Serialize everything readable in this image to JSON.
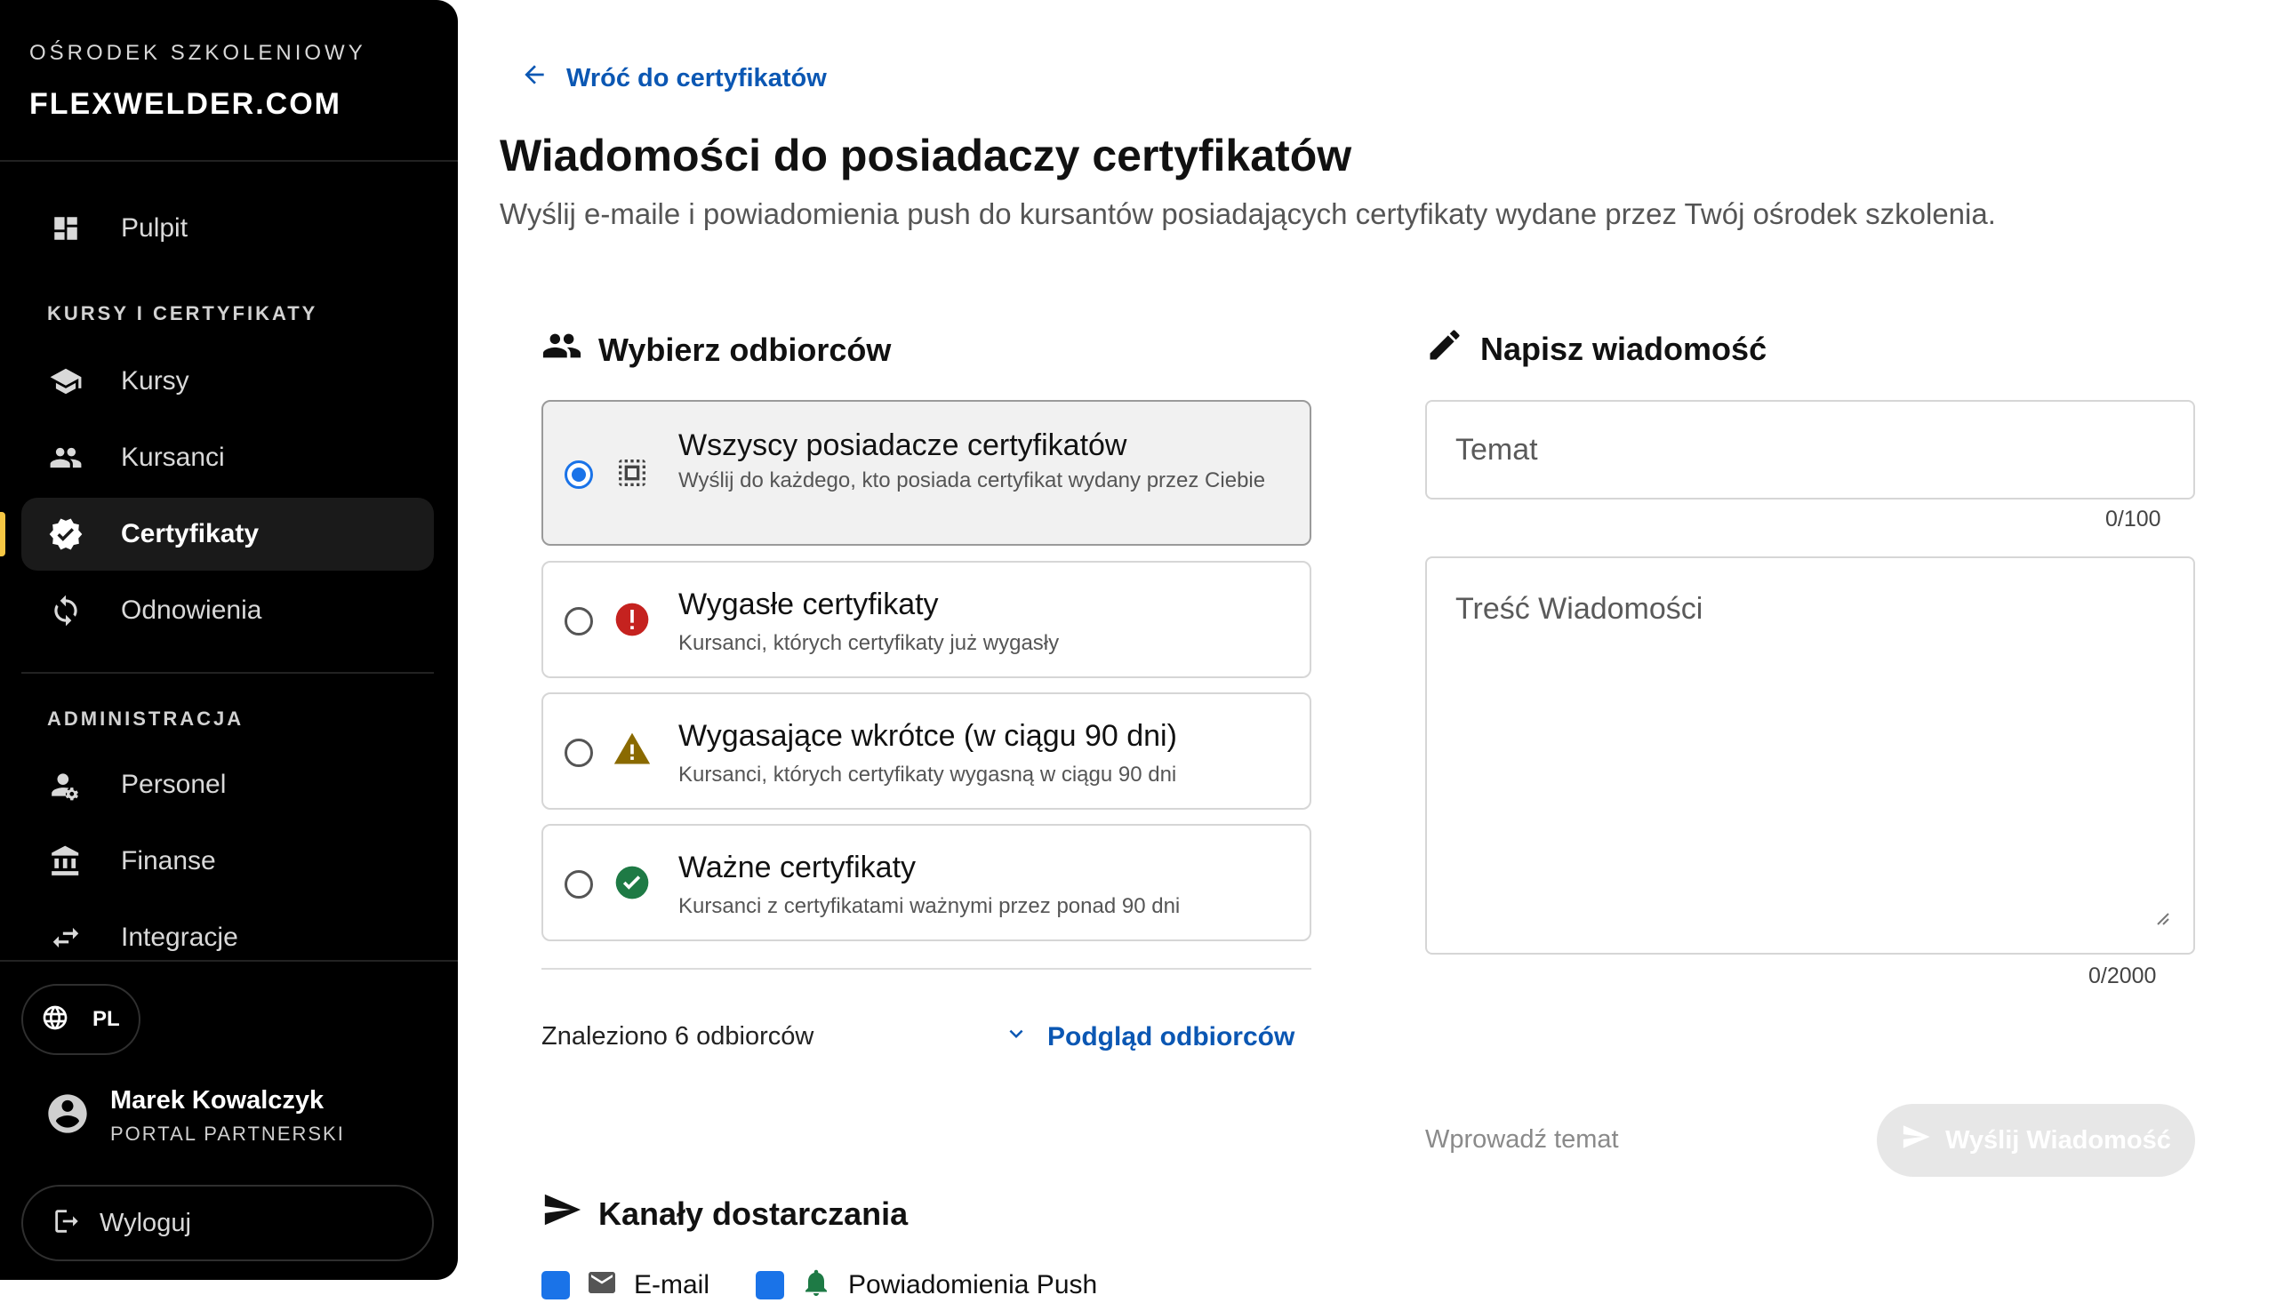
{
  "sidebar": {
    "brand_kicker": "OŚRODEK SZKOLENIOWY",
    "brand_name": "FLEXWELDER.COM",
    "items_top": [
      {
        "label": "Pulpit",
        "icon": "dashboard-icon"
      }
    ],
    "section_courses": "KURSY I CERTYFIKATY",
    "items_courses": [
      {
        "label": "Kursy",
        "icon": "school-icon"
      },
      {
        "label": "Kursanci",
        "icon": "people-icon"
      },
      {
        "label": "Certyfikaty",
        "icon": "verified-badge-icon",
        "active": true
      },
      {
        "label": "Odnowienia",
        "icon": "refresh-icon"
      }
    ],
    "section_admin": "ADMINISTRACJA",
    "items_admin": [
      {
        "label": "Personel",
        "icon": "staff-settings-icon"
      },
      {
        "label": "Finanse",
        "icon": "bank-icon"
      },
      {
        "label": "Integracje",
        "icon": "swap-arrows-icon"
      }
    ],
    "language": "PL",
    "user": {
      "name": "Marek Kowalczyk",
      "role": "PORTAL PARTNERSKI"
    },
    "logout_label": "Wyloguj"
  },
  "main": {
    "back_label": "Wróć do certyfikatów",
    "title": "Wiadomości do posiadaczy certyfikatów",
    "subtitle": "Wyślij e-maile i powiadomienia push do kursantów posiadających certyfikaty wydane przez Twój ośrodek szkolenia.",
    "recipients": {
      "heading": "Wybierz odbiorców",
      "options": [
        {
          "title": "Wszyscy posiadacze certyfikatów",
          "desc": "Wyślij do każdego, kto posiada certyfikat wydany przez Ciebie",
          "selected": true,
          "icon": "select-all-icon"
        },
        {
          "title": "Wygasłe certyfikaty",
          "desc": "Kursanci, których certyfikaty już wygasły",
          "selected": false,
          "icon": "error-icon",
          "color": "#c5221f"
        },
        {
          "title": "Wygasające wkrótce (w ciągu 90 dni)",
          "desc": "Kursanci, których certyfikaty wygasną w ciągu 90 dni",
          "selected": false,
          "icon": "warning-icon",
          "color": "#8a6a00"
        },
        {
          "title": "Ważne certyfikaty",
          "desc": "Kursanci z certyfikatami ważnymi przez ponad 90 dni",
          "selected": false,
          "icon": "check-circle-icon",
          "color": "#1e7a45"
        }
      ],
      "found_text": "Znaleziono 6 odbiorców",
      "preview_label": "Podgląd odbiorców"
    },
    "compose": {
      "heading": "Napisz wiadomość",
      "subject_placeholder": "Temat",
      "subject_counter": "0/100",
      "body_placeholder": "Treść Wiadomości",
      "body_counter": "0/2000",
      "hint": "Wprowadź temat",
      "send_label": "Wyślij Wiadomość"
    },
    "channels": {
      "heading": "Kanały dostarczania",
      "email_label": "E-mail",
      "push_label": "Powiadomienia Push"
    }
  },
  "colors": {
    "accent": "#0b57b3",
    "radio": "#1a73e8",
    "active_marker": "#f6c744"
  }
}
